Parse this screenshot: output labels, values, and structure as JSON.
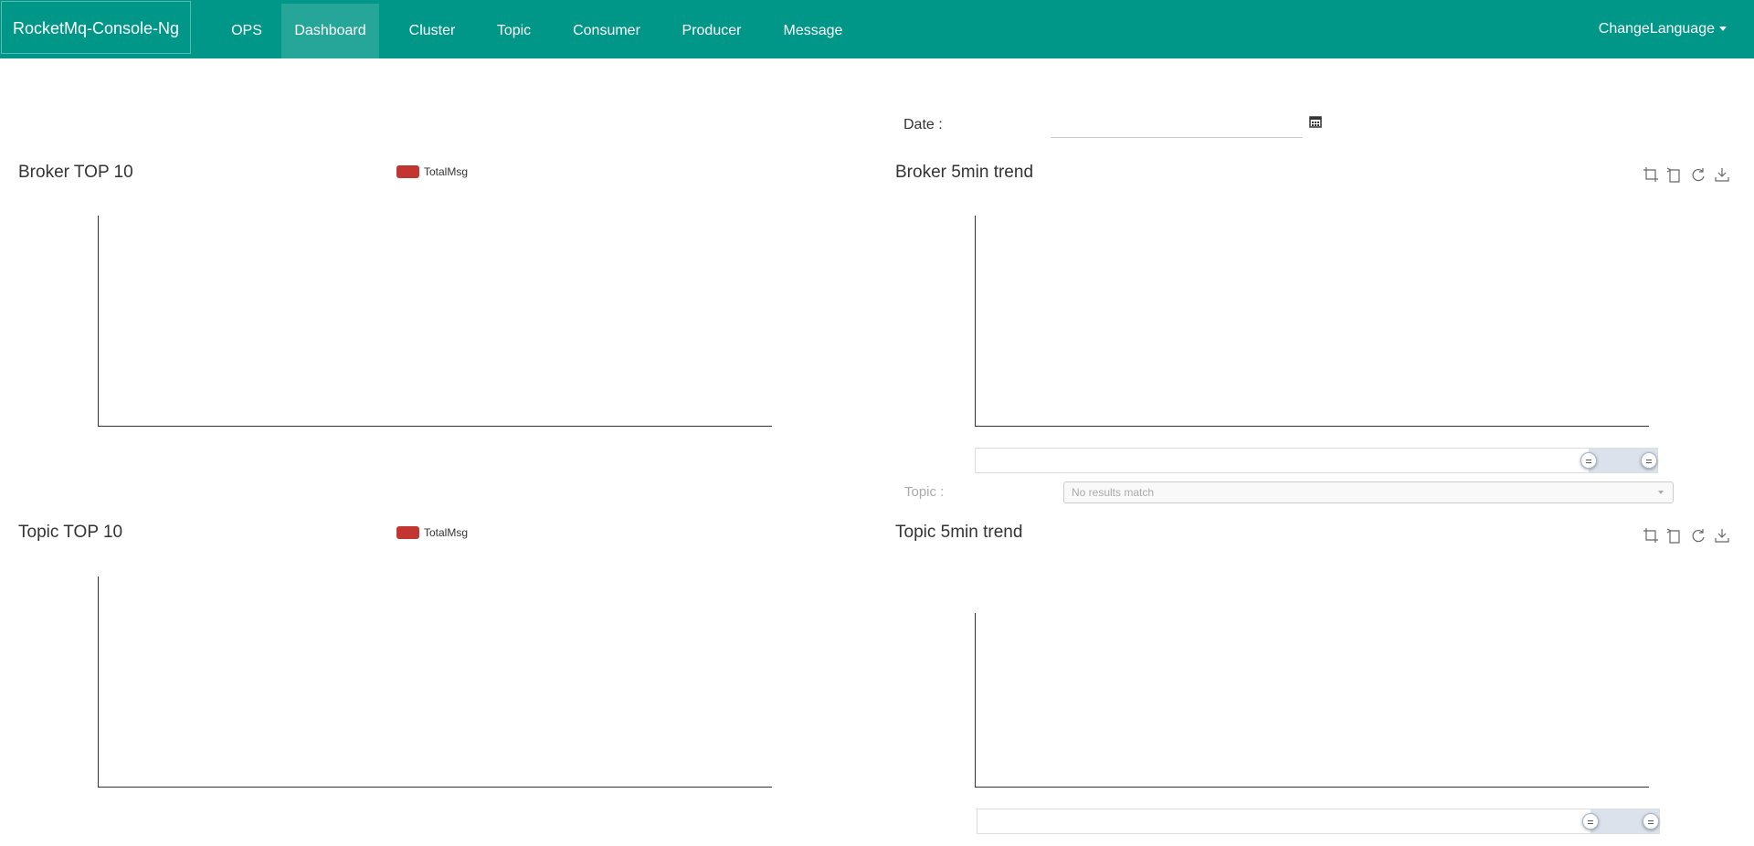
{
  "navbar": {
    "brand": "RocketMq-Console-Ng",
    "items": [
      {
        "label": "OPS",
        "active": false
      },
      {
        "label": "Dashboard",
        "active": true
      },
      {
        "label": "Cluster",
        "active": false
      },
      {
        "label": "Topic",
        "active": false
      },
      {
        "label": "Consumer",
        "active": false
      },
      {
        "label": "Producer",
        "active": false
      },
      {
        "label": "Message",
        "active": false
      }
    ],
    "language": "ChangeLanguage"
  },
  "date": {
    "label": "Date :",
    "value": ""
  },
  "broker_top": {
    "title": "Broker TOP 10",
    "legend": "TotalMsg"
  },
  "broker_trend": {
    "title": "Broker 5min trend"
  },
  "topic_filter": {
    "label": "Topic :",
    "placeholder": "No results match"
  },
  "topic_top": {
    "title": "Topic TOP 10",
    "legend": "TotalMsg"
  },
  "topic_trend": {
    "title": "Topic 5min trend"
  },
  "colors": {
    "primary": "#009688",
    "legend": "#c23531"
  },
  "dataZoom": {
    "start_percent": 90,
    "end_percent": 100
  }
}
